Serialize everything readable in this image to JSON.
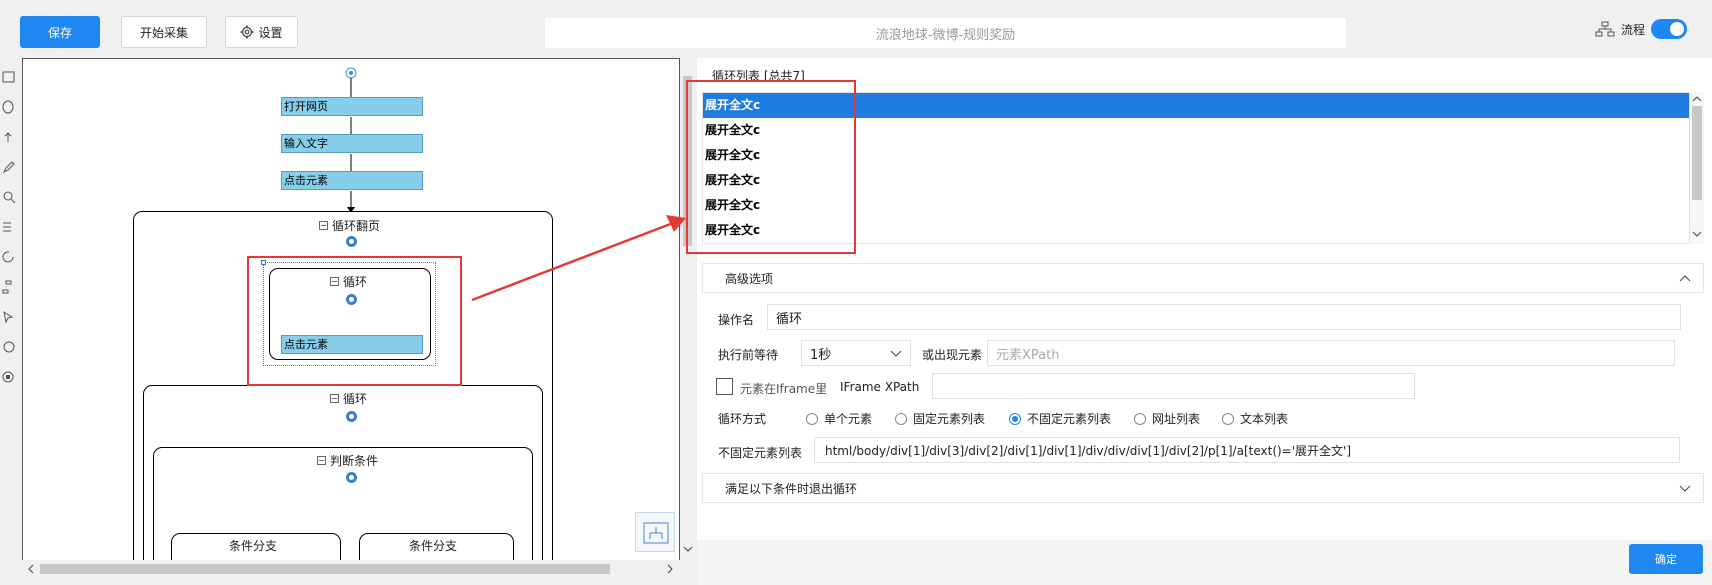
{
  "toolbar": {
    "save_label": "保存",
    "start_label": "开始采集",
    "settings_label": "设置"
  },
  "header": {
    "task_title": "流浪地球-微博-规则奖励",
    "flow_label": "流程"
  },
  "flow": {
    "nodes": {
      "open_page": "打开网页",
      "input_text": "输入文字",
      "click_element_1": "点击元素",
      "loop_page": "循环翻页",
      "loop_inner": "循环",
      "click_element_2": "点击元素",
      "loop_second": "循环",
      "condition": "判断条件",
      "branch_1": "条件分支",
      "branch_2": "条件分支"
    }
  },
  "panel": {
    "list_title": "循环列表 [总共7]",
    "loop_items": [
      "展开全文c",
      "展开全文c",
      "展开全文c",
      "展开全文c",
      "展开全文c",
      "展开全文c"
    ],
    "advanced_label": "高级选项",
    "op_name_label": "操作名",
    "op_name_value": "循环",
    "wait_label": "执行前等待",
    "wait_value": "1秒",
    "or_appear_label": "或出现元素",
    "xpath_placeholder": "元素XPath",
    "iframe_check_label": "元素在Iframe里",
    "iframe_xpath_label": "IFrame XPath",
    "loop_mode_label": "循环方式",
    "modes": [
      "单个元素",
      "固定元素列表",
      "不固定元素列表",
      "网址列表",
      "文本列表"
    ],
    "unfixed_list_label": "不固定元素列表",
    "unfixed_list_value": "html/body/div[1]/div[3]/div[2]/div[1]/div[1]/div/div/div[1]/div[2]/p[1]/a[text()='展开全文']",
    "exit_condition_label": "满足以下条件时退出循环",
    "confirm_label": "确定"
  },
  "colors": {
    "accent": "#1e87f0",
    "highlight": "#e53935",
    "node_fill": "#87ceeb"
  }
}
